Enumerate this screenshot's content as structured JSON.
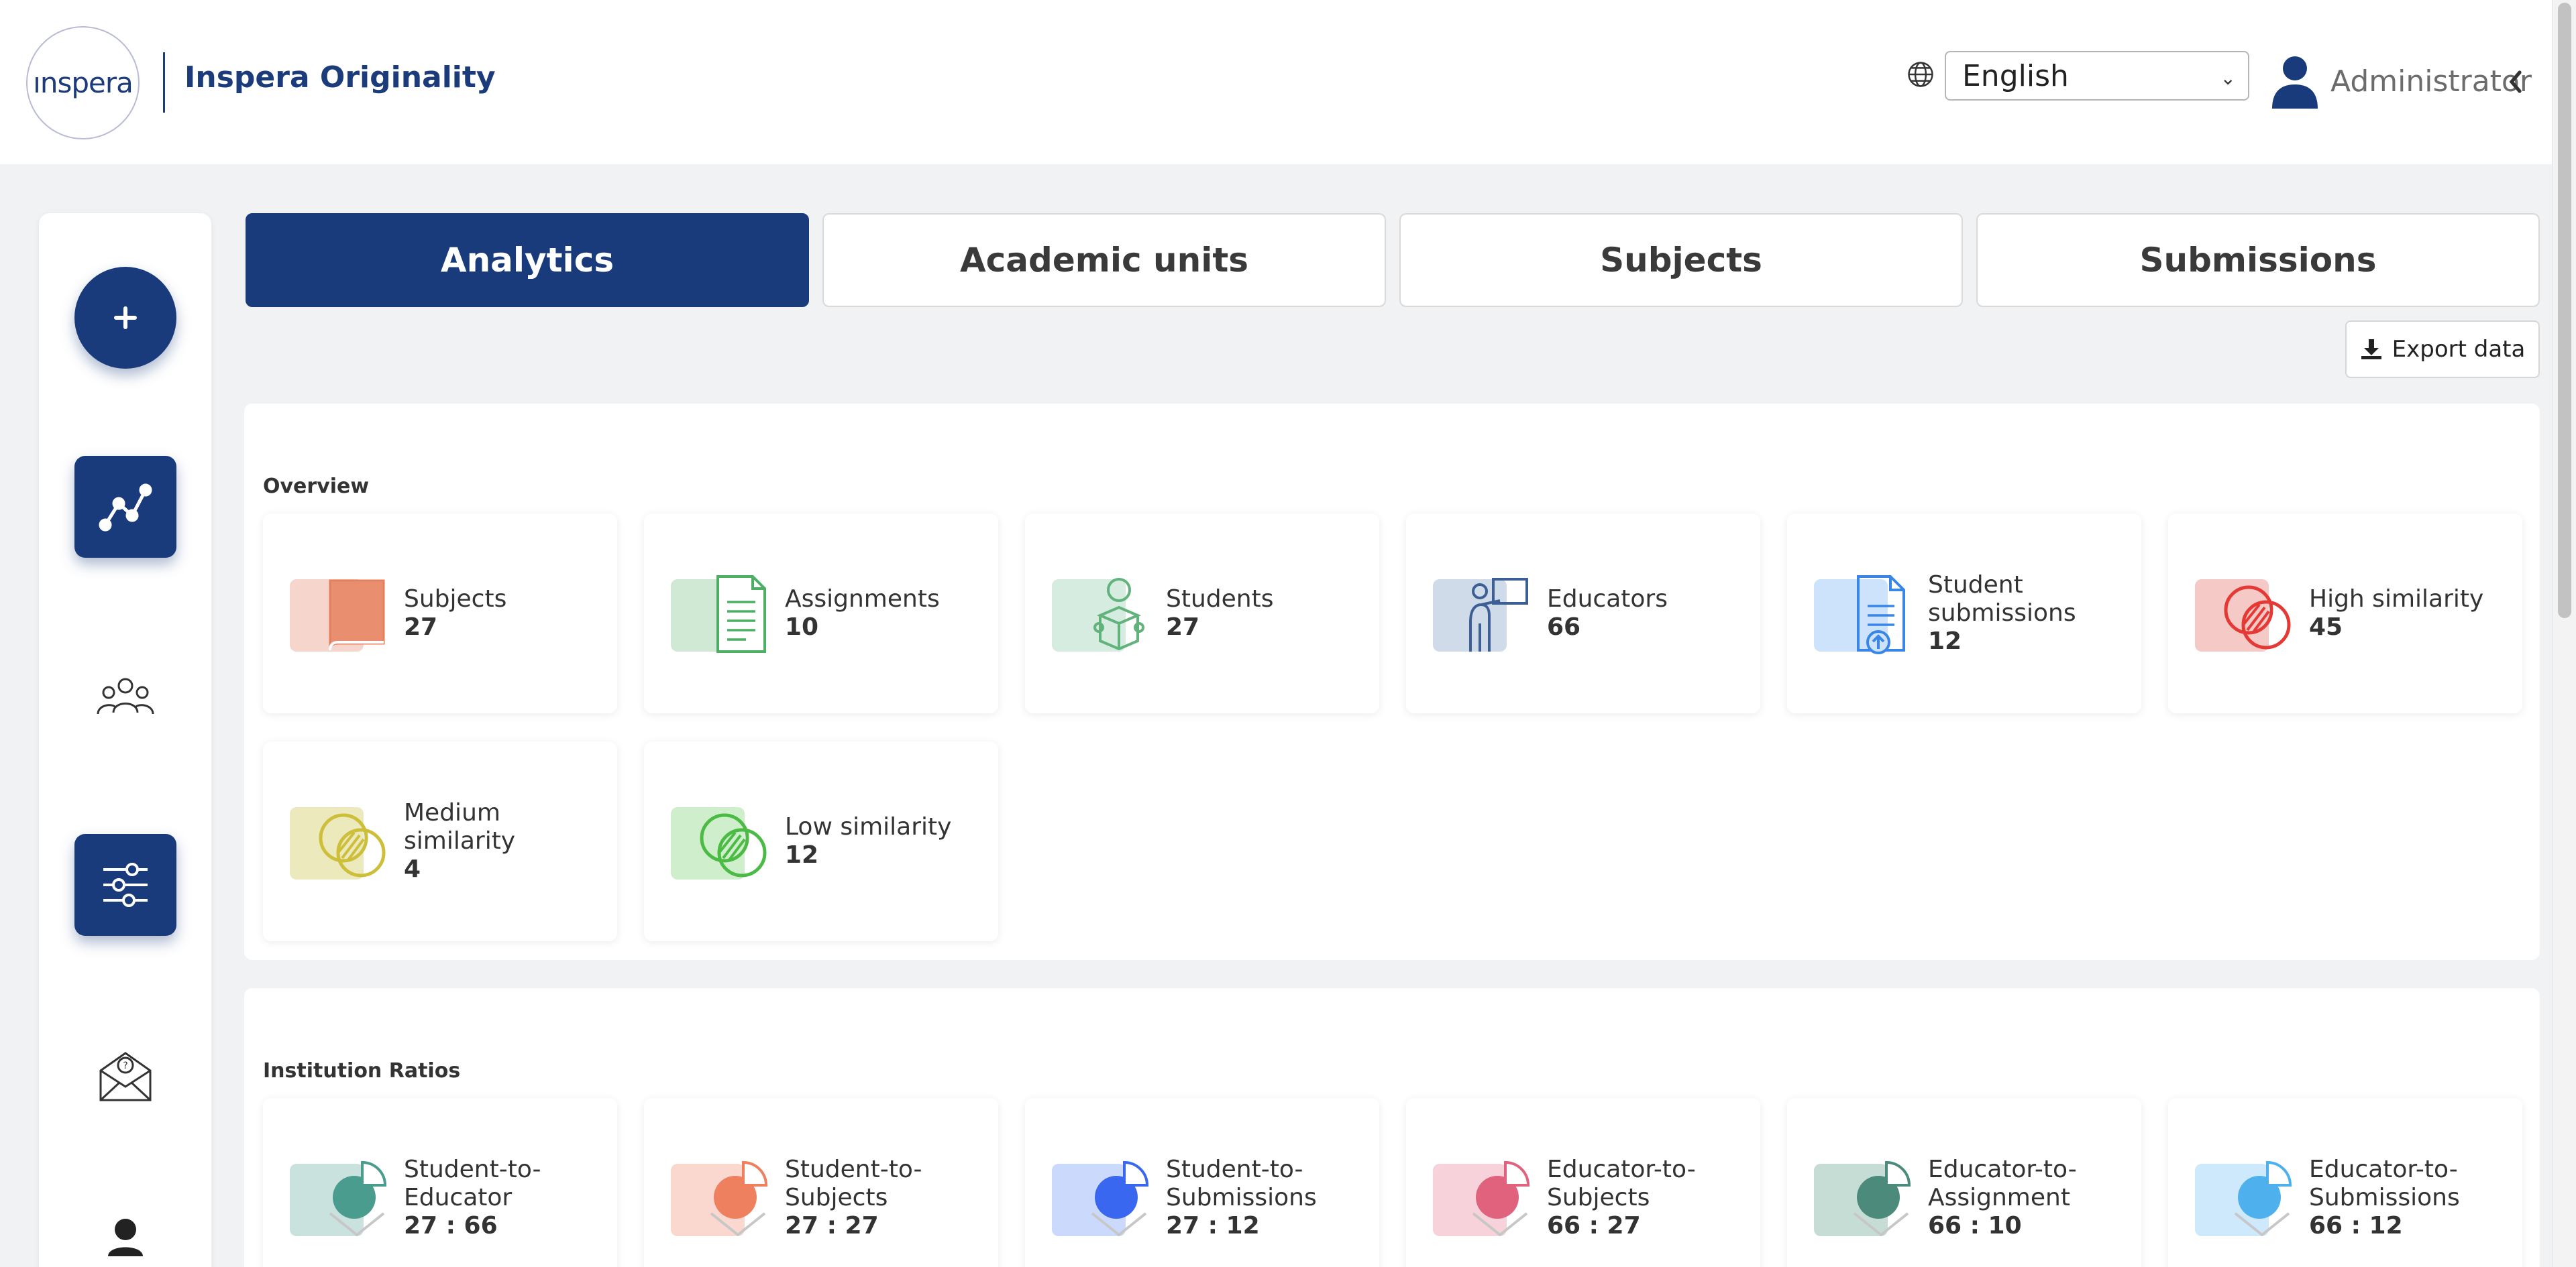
{
  "header": {
    "logo_text": "ınspera",
    "brand": "Inspera Originality",
    "language": "English",
    "user": "Administrator"
  },
  "tabs": [
    {
      "label": "Analytics",
      "active": true
    },
    {
      "label": "Academic units",
      "active": false
    },
    {
      "label": "Subjects",
      "active": false
    },
    {
      "label": "Submissions",
      "active": false
    }
  ],
  "export_label": "Export data",
  "overview": {
    "title": "Overview",
    "cards": [
      {
        "label": "Subjects",
        "value": "27",
        "icon": "book-icon"
      },
      {
        "label": "Assignments",
        "value": "10",
        "icon": "document-icon"
      },
      {
        "label": "Students",
        "value": "27",
        "icon": "student-icon"
      },
      {
        "label": "Educators",
        "value": "66",
        "icon": "educator-icon"
      },
      {
        "label": "Student submissions",
        "value": "12",
        "icon": "upload-document-icon"
      },
      {
        "label": "High similarity",
        "value": "45",
        "icon": "high-similarity-icon"
      },
      {
        "label": "Medium similarity",
        "value": "4",
        "icon": "medium-similarity-icon"
      },
      {
        "label": "Low similarity",
        "value": "12",
        "icon": "low-similarity-icon"
      }
    ]
  },
  "ratios": {
    "title": "Institution Ratios",
    "cards": [
      {
        "label": "Student-to-Educator",
        "value": "27 : 66",
        "icon": "pie-chart-icon"
      },
      {
        "label": "Student-to-Subjects",
        "value": "27 : 27",
        "icon": "pie-chart-icon"
      },
      {
        "label": "Student-to-Submissions",
        "value": "27 : 12",
        "icon": "pie-chart-icon"
      },
      {
        "label": "Educator-to-Subjects",
        "value": "66 : 27",
        "icon": "pie-chart-icon"
      },
      {
        "label": "Educator-to-Assignment",
        "value": "66 : 10",
        "icon": "pie-chart-icon"
      },
      {
        "label": "Educator-to-Submissions",
        "value": "66 : 12",
        "icon": "pie-chart-icon"
      }
    ]
  },
  "colors": {
    "primary": "#1a3b7b",
    "background": "#f1f2f4"
  }
}
